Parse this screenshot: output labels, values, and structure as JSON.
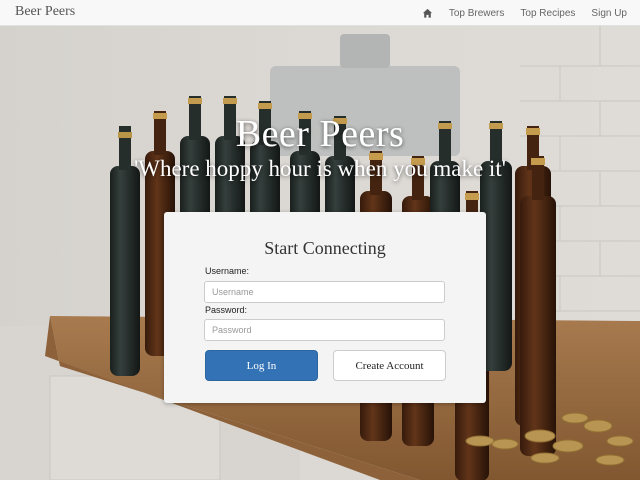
{
  "navbar": {
    "brand": "Beer Peers",
    "home_icon": "home-icon",
    "links": [
      "Top Brewers",
      "Top Recipes",
      "Sign Up"
    ]
  },
  "hero": {
    "title": "Beer Peers",
    "tagline": "'Where hoppy hour is when you make it'"
  },
  "login_form": {
    "title": "Start Connecting",
    "username_label": "Username:",
    "username_placeholder": "Username",
    "username_value": "",
    "password_label": "Password:",
    "password_placeholder": "Password",
    "password_value": "",
    "login_button": "Log In",
    "create_account_button": "Create Account"
  },
  "colors": {
    "primary_button": "#3373b5",
    "navbar_bg": "#f8f8f8",
    "card_bg": "#f4f4f4"
  }
}
